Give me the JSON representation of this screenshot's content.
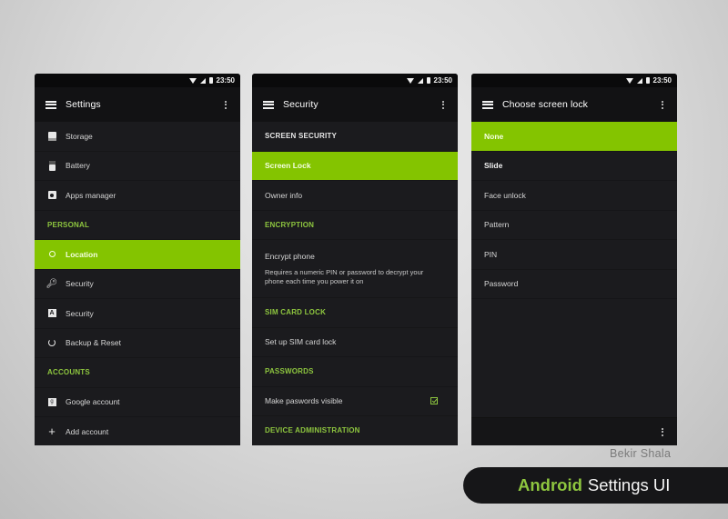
{
  "status_bar": {
    "time": "23:50"
  },
  "screens": [
    {
      "title": "Settings",
      "items": [
        {
          "type": "item",
          "label": "Storage",
          "icon": "storage-icon"
        },
        {
          "type": "item",
          "label": "Battery",
          "icon": "battery-icon"
        },
        {
          "type": "item",
          "label": "Apps manager",
          "icon": "apps-icon"
        },
        {
          "type": "header",
          "label": "PERSONAL"
        },
        {
          "type": "item",
          "label": "Location",
          "icon": "location-icon",
          "active": true
        },
        {
          "type": "item",
          "label": "Security",
          "icon": "key-icon"
        },
        {
          "type": "item",
          "label": "Security",
          "icon": "language-icon"
        },
        {
          "type": "item",
          "label": "Backup & Reset",
          "icon": "backup-icon"
        },
        {
          "type": "header",
          "label": "ACCOUNTS"
        },
        {
          "type": "item",
          "label": "Google account",
          "icon": "google-icon"
        },
        {
          "type": "item",
          "label": "Add account",
          "icon": "plus-icon"
        }
      ]
    },
    {
      "title": "Security",
      "items": [
        {
          "type": "header-white",
          "label": "SCREEN SECURITY"
        },
        {
          "type": "item",
          "label": "Screen Lock",
          "active": true
        },
        {
          "type": "item",
          "label": "Owner info"
        },
        {
          "type": "header",
          "label": "ENCRYPTION"
        },
        {
          "type": "tall",
          "label": "Encrypt phone",
          "sub": "Requires a numeric PIN or password to decrypt your phone each time you power it on"
        },
        {
          "type": "header",
          "label": "SIM CARD LOCK"
        },
        {
          "type": "item",
          "label": "Set up SIM card lock"
        },
        {
          "type": "header",
          "label": "PASSWORDS"
        },
        {
          "type": "checkbox",
          "label": "Make paswords visible",
          "checked": true
        },
        {
          "type": "header",
          "label": "DEVICE ADMINISTRATION"
        }
      ]
    },
    {
      "title": "Choose screen lock",
      "items": [
        {
          "type": "item",
          "label": "None",
          "active": true
        },
        {
          "type": "bold",
          "label": "Slide"
        },
        {
          "type": "item",
          "label": "Face unlock"
        },
        {
          "type": "item",
          "label": "Pattern"
        },
        {
          "type": "item",
          "label": "PIN"
        },
        {
          "type": "item",
          "label": "Password"
        }
      ]
    }
  ],
  "footer": {
    "author": "Bekir Shala",
    "banner_accent": "Android",
    "banner_rest": "Settings UI"
  },
  "colors": {
    "accent": "#84c400",
    "accent_text": "#8ec63f",
    "panel": "#1b1b1e"
  }
}
